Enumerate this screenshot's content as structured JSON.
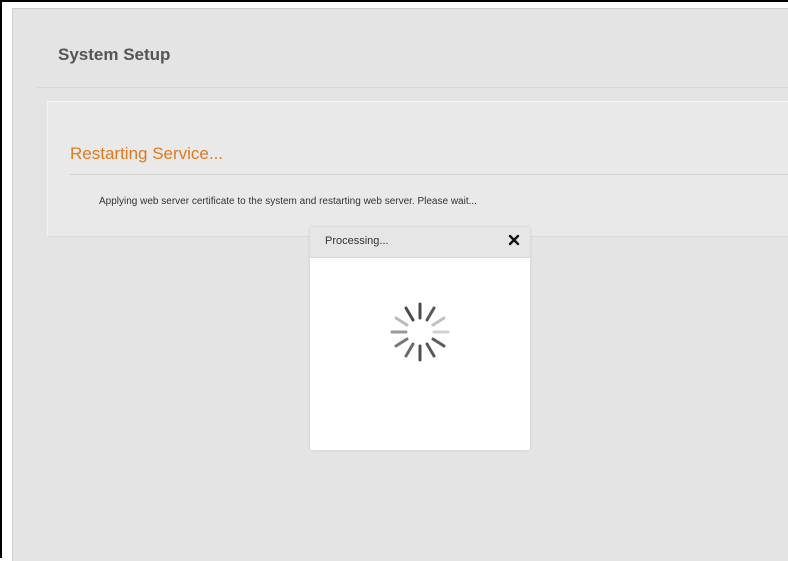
{
  "page": {
    "title": "System Setup"
  },
  "panel": {
    "heading": "Restarting Service...",
    "message": "Applying web server certificate to the system and restarting web server. Please wait..."
  },
  "dialog": {
    "title": "Processing...",
    "close_icon": "close-icon",
    "spinner_icon": "loading-spinner-icon"
  },
  "colors": {
    "accent": "#e07a1e",
    "background": "#e4e4e4",
    "panel": "#e9e9e9",
    "dialog": "#ffffff"
  }
}
